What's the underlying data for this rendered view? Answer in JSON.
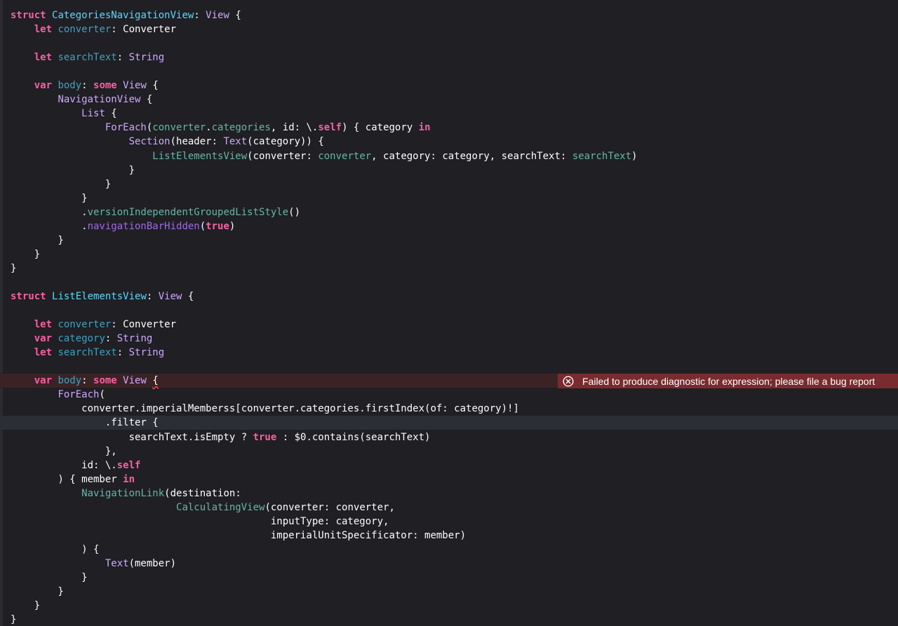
{
  "editor": {
    "lines": [
      [
        [
          "struct ",
          "kw"
        ],
        [
          "CategoriesNavigationView",
          "tdecl"
        ],
        [
          ": ",
          "plain"
        ],
        [
          "View",
          "type"
        ],
        [
          " {",
          "plain"
        ]
      ],
      [
        [
          "    ",
          "plain"
        ],
        [
          "let ",
          "kw"
        ],
        [
          "converter",
          "pdecl"
        ],
        [
          ": ",
          "plain"
        ],
        [
          "Converter",
          "plain"
        ]
      ],
      [],
      [
        [
          "    ",
          "plain"
        ],
        [
          "let ",
          "kw"
        ],
        [
          "searchText",
          "pdecl"
        ],
        [
          ": ",
          "plain"
        ],
        [
          "String",
          "type"
        ]
      ],
      [],
      [
        [
          "    ",
          "plain"
        ],
        [
          "var ",
          "kw"
        ],
        [
          "body",
          "pdecl"
        ],
        [
          ": ",
          "plain"
        ],
        [
          "some ",
          "kw"
        ],
        [
          "View",
          "type"
        ],
        [
          " {",
          "plain"
        ]
      ],
      [
        [
          "        ",
          "plain"
        ],
        [
          "NavigationView",
          "type"
        ],
        [
          " {",
          "plain"
        ]
      ],
      [
        [
          "            ",
          "plain"
        ],
        [
          "List",
          "type"
        ],
        [
          " {",
          "plain"
        ]
      ],
      [
        [
          "                ",
          "plain"
        ],
        [
          "ForEach",
          "type"
        ],
        [
          "(",
          "plain"
        ],
        [
          "converter",
          "fn"
        ],
        [
          ".",
          "plain"
        ],
        [
          "categories",
          "fn"
        ],
        [
          ", id: \\.",
          "plain"
        ],
        [
          "self",
          "kw"
        ],
        [
          ") { category ",
          "plain"
        ],
        [
          "in",
          "kw"
        ]
      ],
      [
        [
          "                    ",
          "plain"
        ],
        [
          "Section",
          "type"
        ],
        [
          "(header: ",
          "plain"
        ],
        [
          "Text",
          "type"
        ],
        [
          "(category)) {",
          "plain"
        ]
      ],
      [
        [
          "                        ",
          "plain"
        ],
        [
          "ListElementsView",
          "fn"
        ],
        [
          "(converter: ",
          "plain"
        ],
        [
          "converter",
          "fn"
        ],
        [
          ", category: category, searchText: ",
          "plain"
        ],
        [
          "searchText",
          "fn"
        ],
        [
          ")",
          "plain"
        ]
      ],
      [
        [
          "                    }",
          "plain"
        ]
      ],
      [
        [
          "                }",
          "plain"
        ]
      ],
      [
        [
          "            }",
          "plain"
        ]
      ],
      [
        [
          "            .",
          "plain"
        ],
        [
          "versionIndependentGroupedListStyle",
          "fn"
        ],
        [
          "()",
          "plain"
        ]
      ],
      [
        [
          "            .",
          "plain"
        ],
        [
          "navigationBarHidden",
          "ptype"
        ],
        [
          "(",
          "plain"
        ],
        [
          "true",
          "kw"
        ],
        [
          ")",
          "plain"
        ]
      ],
      [
        [
          "        }",
          "plain"
        ]
      ],
      [
        [
          "    }",
          "plain"
        ]
      ],
      [
        [
          "}",
          "plain"
        ]
      ],
      [],
      [
        [
          "struct ",
          "kw"
        ],
        [
          "ListElementsView",
          "tdecl"
        ],
        [
          ": ",
          "plain"
        ],
        [
          "View",
          "type"
        ],
        [
          " {",
          "plain"
        ]
      ],
      [],
      [
        [
          "    ",
          "plain"
        ],
        [
          "let ",
          "kw"
        ],
        [
          "converter",
          "pdecl"
        ],
        [
          ": ",
          "plain"
        ],
        [
          "Converter",
          "plain"
        ]
      ],
      [
        [
          "    ",
          "plain"
        ],
        [
          "var ",
          "kw"
        ],
        [
          "category",
          "pdecl"
        ],
        [
          ": ",
          "plain"
        ],
        [
          "String",
          "type"
        ]
      ],
      [
        [
          "    ",
          "plain"
        ],
        [
          "let ",
          "kw"
        ],
        [
          "searchText",
          "pdecl"
        ],
        [
          ": ",
          "plain"
        ],
        [
          "String",
          "type"
        ]
      ],
      [],
      [
        [
          "    ",
          "plain"
        ],
        [
          "var ",
          "kw"
        ],
        [
          "body",
          "pdecl"
        ],
        [
          ": ",
          "plain"
        ],
        [
          "some ",
          "kw"
        ],
        [
          "View",
          "type"
        ],
        [
          " ",
          "plain"
        ],
        [
          "{",
          "squiggle"
        ]
      ],
      [
        [
          "        ",
          "plain"
        ],
        [
          "ForEach",
          "type"
        ],
        [
          "(",
          "plain"
        ]
      ],
      [
        [
          "            converter.imperialMemberss[converter.categories.firstIndex(of: category)!]",
          "plain"
        ]
      ],
      [
        [
          "                .filter {",
          "plain"
        ]
      ],
      [
        [
          "                    searchText.isEmpty ? ",
          "plain"
        ],
        [
          "true",
          "kw"
        ],
        [
          " : $0.contains(searchText)",
          "plain"
        ]
      ],
      [
        [
          "                },",
          "plain"
        ]
      ],
      [
        [
          "            id: \\.",
          "plain"
        ],
        [
          "self",
          "kw"
        ]
      ],
      [
        [
          "        ) { member ",
          "plain"
        ],
        [
          "in",
          "kw"
        ]
      ],
      [
        [
          "            ",
          "plain"
        ],
        [
          "NavigationLink",
          "fn"
        ],
        [
          "(destination:",
          "plain"
        ]
      ],
      [
        [
          "                            ",
          "plain"
        ],
        [
          "CalculatingView",
          "fn"
        ],
        [
          "(converter: converter,",
          "plain"
        ]
      ],
      [
        [
          "                                            inputType: category,",
          "plain"
        ]
      ],
      [
        [
          "                                            imperialUnitSpecificator: member)",
          "plain"
        ]
      ],
      [
        [
          "            ) {",
          "plain"
        ]
      ],
      [
        [
          "                ",
          "plain"
        ],
        [
          "Text",
          "type"
        ],
        [
          "(member)",
          "plain"
        ]
      ],
      [
        [
          "            }",
          "plain"
        ]
      ],
      [
        [
          "        }",
          "plain"
        ]
      ],
      [
        [
          "    }",
          "plain"
        ]
      ],
      [
        [
          "}",
          "plain"
        ]
      ]
    ],
    "error_line_index": 26,
    "current_line_index": 29
  },
  "diagnostic": {
    "icon": "error-circle-x-icon",
    "message": "Failed to produce diagnostic for expression; please file a bug report"
  },
  "colors": {
    "background": "#1f1f24",
    "keyword": "#fc5fa3",
    "type_declaration": "#5dd8ff",
    "type": "#d0a8ff",
    "property_declaration": "#41a1c0",
    "project_symbol": "#67b7a4",
    "error_background": "#7a2b2f"
  }
}
